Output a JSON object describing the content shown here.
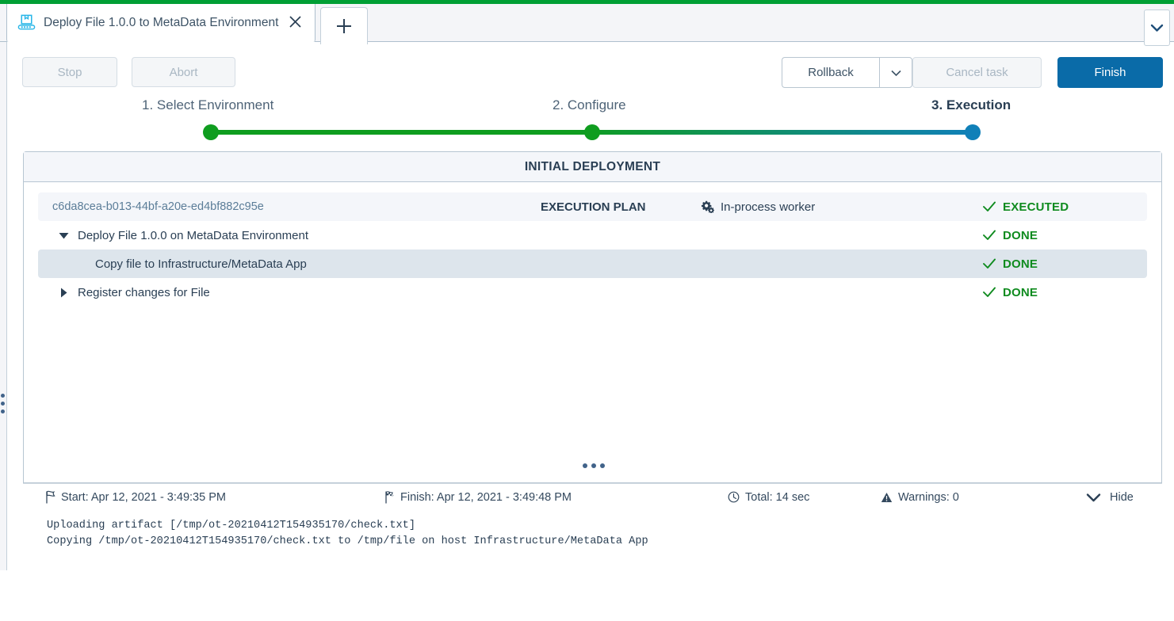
{
  "window": {
    "accent_color": "#009f34",
    "tab": {
      "icon": "deployment-conveyor-icon",
      "title": "Deploy File 1.0.0 to MetaData Environment",
      "close_label": "✕"
    },
    "new_tab_label": "+",
    "overflow_label": "⌄"
  },
  "toolbar": {
    "stop_label": "Stop",
    "abort_label": "Abort",
    "rollback_label": "Rollback",
    "rollback_caret": "▾",
    "cancel_task_label": "Cancel task",
    "finish_label": "Finish",
    "finish_color": "#0a6ba8"
  },
  "steps": {
    "items": [
      {
        "label": "1. Select Environment",
        "state": "complete",
        "color": "#0f9d1f"
      },
      {
        "label": "2. Configure",
        "state": "complete",
        "color": "#0f9d1f"
      },
      {
        "label": "3. Execution",
        "state": "active",
        "color": "#1080b8"
      }
    ]
  },
  "panel": {
    "header": "INITIAL DEPLOYMENT",
    "plan_row": {
      "id": "c6da8cea-b013-44bf-a20e-ed4bf882c95e",
      "plan_label": "EXECUTION PLAN",
      "worker_icon": "gears-icon",
      "worker": "In-process worker",
      "status": "EXECUTED",
      "status_color": "#0f8b1f"
    },
    "tasks": [
      {
        "label": "Deploy File 1.0.0 on MetaData Environment",
        "toggle": "expanded",
        "status": "DONE",
        "selected": false
      },
      {
        "label": "Copy file to Infrastructure/MetaData App",
        "toggle": "none",
        "status": "DONE",
        "selected": true
      },
      {
        "label": "Register changes for File",
        "toggle": "collapsed",
        "status": "DONE",
        "selected": false
      }
    ]
  },
  "statusbar": {
    "start_icon": "flag-outline-icon",
    "start": "Start: Apr 12, 2021 - 3:49:35 PM",
    "finish_icon": "flag-checkered-icon",
    "finish": "Finish: Apr 12, 2021 - 3:49:48 PM",
    "total_icon": "clock-icon",
    "total": "Total: 14 sec",
    "warnings_icon": "warning-triangle-icon",
    "warnings": "Warnings: 0",
    "hide_icon": "chevron-down-icon",
    "hide_label": "Hide"
  },
  "log": {
    "lines": "Uploading artifact [/tmp/ot-20210412T154935170/check.txt]\nCopying /tmp/ot-20210412T154935170/check.txt to /tmp/file on host Infrastructure/MetaData App"
  }
}
